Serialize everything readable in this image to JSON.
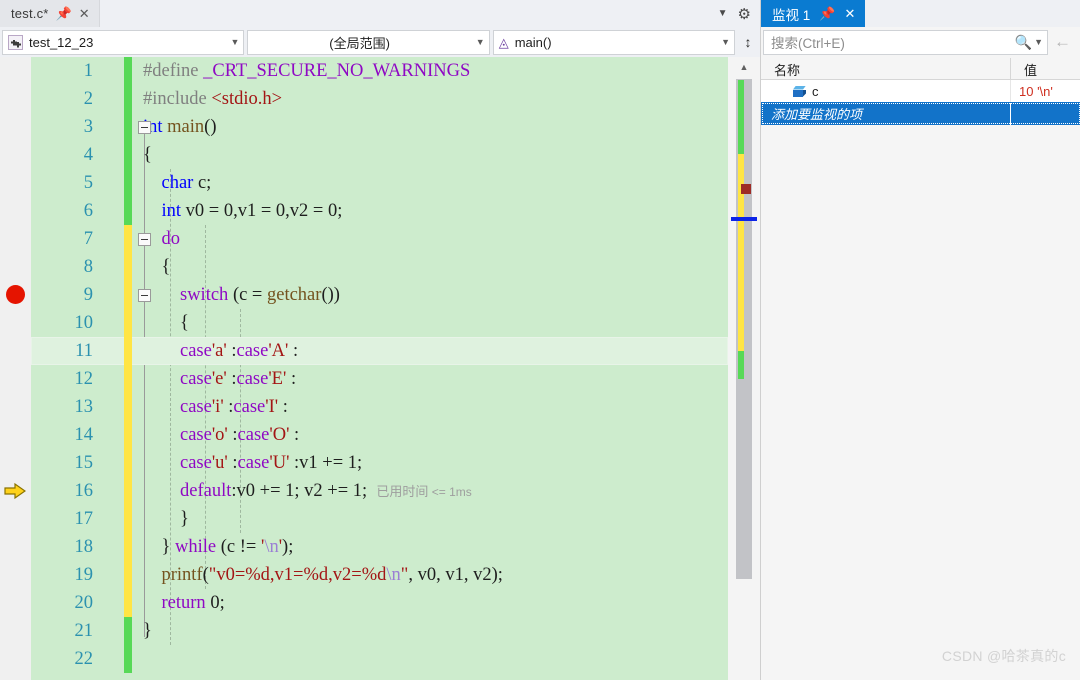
{
  "editor": {
    "tab": {
      "title": "test.c*",
      "pin_icon": "pin-icon",
      "close_icon": "close-icon"
    },
    "tabstrip_right": {
      "dropdown_icon": "chevron-down-icon",
      "settings_icon": "gear-icon"
    },
    "navbar": {
      "project": "test_12_23",
      "scope": "(全局范围)",
      "member": "main()",
      "split_icon": "split-window-icon",
      "caret_icon": "chevron-down-icon"
    },
    "gutter": {
      "breakpoint_line": 9,
      "current_line_marker_line": 16,
      "current_highlight_line": 11
    },
    "lines": [
      {
        "n": 1,
        "bar": "green",
        "html": "<span class='pp'>#define</span> <span class='mac'>_CRT_SECURE_NO_WARNINGS</span>",
        "text": "#define _CRT_SECURE_NO_WARNINGS"
      },
      {
        "n": 2,
        "bar": "green",
        "html": "<span class='pp'>#include</span> <span class='str'>&lt;stdio.h&gt;</span>",
        "text": "#include <stdio.h>"
      },
      {
        "n": 3,
        "bar": "green",
        "html": "<span class='k'>int</span> <span class='fn'>main</span><span class='pl'>()</span>",
        "text": "int main()"
      },
      {
        "n": 4,
        "bar": "green",
        "html": "<span class='pl'>{</span>",
        "text": "{"
      },
      {
        "n": 5,
        "bar": "green",
        "html": "    <span class='k'>char</span> <span class='pl'>c;</span>",
        "text": "    char c;"
      },
      {
        "n": 6,
        "bar": "green",
        "html": "    <span class='k'>int</span> <span class='pl'>v0 = 0,v1 = 0,v2 = 0;</span>",
        "text": "    int v0 = 0,v1 = 0,v2 = 0;"
      },
      {
        "n": 7,
        "bar": "yellow",
        "html": "    <span class='kw'>do</span>",
        "text": "    do"
      },
      {
        "n": 8,
        "bar": "yellow",
        "html": "    <span class='pl'>{</span>",
        "text": "    {"
      },
      {
        "n": 9,
        "bar": "yellow",
        "html": "        <span class='kw'>switch</span> <span class='pl'>(c = </span><span class='fn'>getchar</span><span class='pl'>())</span>",
        "text": "        switch (c = getchar())"
      },
      {
        "n": 10,
        "bar": "yellow",
        "html": "        <span class='pl'>{</span>",
        "text": "        {"
      },
      {
        "n": 11,
        "bar": "yellow",
        "html": "        <span class='kw'>case</span><span class='str'>'a'</span> <span class='pl'>:</span><span class='kw'>case</span><span class='str'>'A'</span> <span class='pl'>:</span>",
        "text": "        case'a' :case'A' :"
      },
      {
        "n": 12,
        "bar": "yellow",
        "html": "        <span class='kw'>case</span><span class='str'>'e'</span> <span class='pl'>:</span><span class='kw'>case</span><span class='str'>'E'</span> <span class='pl'>:</span>",
        "text": "        case'e' :case'E' :"
      },
      {
        "n": 13,
        "bar": "yellow",
        "html": "        <span class='kw'>case</span><span class='str'>'i'</span> <span class='pl'>:</span><span class='kw'>case</span><span class='str'>'I'</span> <span class='pl'>:</span>",
        "text": "        case'i' :case'I' :"
      },
      {
        "n": 14,
        "bar": "yellow",
        "html": "        <span class='kw'>case</span><span class='str'>'o'</span> <span class='pl'>:</span><span class='kw'>case</span><span class='str'>'O'</span> <span class='pl'>:</span>",
        "text": "        case'o' :case'O' :"
      },
      {
        "n": 15,
        "bar": "yellow",
        "html": "        <span class='kw'>case</span><span class='str'>'u'</span> <span class='pl'>:</span><span class='kw'>case</span><span class='str'>'U'</span> <span class='pl'>:v1 += 1;</span>",
        "text": "        case'u' :case'U' :v1 += 1;"
      },
      {
        "n": 16,
        "bar": "yellow",
        "html": "        <span class='kw'>default</span><span class='pl'>:v0 += 1; v2 += 1;</span>  <span class='tip'>已用时间<span class='small'> &lt;= 1ms</span></span>",
        "text": "        default:v0 += 1; v2 += 1;"
      },
      {
        "n": 17,
        "bar": "yellow",
        "html": "        <span class='pl'>}</span>",
        "text": "        }"
      },
      {
        "n": 18,
        "bar": "yellow",
        "html": "    <span class='pl'>}</span> <span class='kw'>while</span> <span class='pl'>(c != </span><span class='str'>'</span><span class='esc'>\\n</span><span class='str'>'</span><span class='pl'>);</span>",
        "text": "    } while (c != '\\n');"
      },
      {
        "n": 19,
        "bar": "yellow",
        "html": "    <span class='fn'>printf</span><span class='pl'>(</span><span class='str'>\"v0=%d,v1=%d,v2=%d</span><span class='esc'>\\n</span><span class='str'>\"</span><span class='pl'>, v0, v1, v2);</span>",
        "text": "    printf(\"v0=%d,v1=%d,v2=%d\\n\", v0, v1, v2);"
      },
      {
        "n": 20,
        "bar": "yellow",
        "html": "    <span class='kw'>return</span> <span class='pl'>0;</span>",
        "text": "    return 0;"
      },
      {
        "n": 21,
        "bar": "green",
        "html": "<span class='pl'>}</span>",
        "text": "}"
      },
      {
        "n": 22,
        "bar": "green",
        "html": "",
        "text": ""
      }
    ],
    "elapsed_tip": "已用时间 <= 1ms",
    "scrollbar": {
      "up_icon": "scroll-up-icon"
    }
  },
  "watch": {
    "tab": {
      "title": "监视 1",
      "pin_icon": "pin-icon",
      "close_icon": "close-icon"
    },
    "search": {
      "placeholder": "搜索(Ctrl+E)",
      "value": "",
      "icon": "search-icon",
      "caret_icon": "chevron-down-icon"
    },
    "nav_back_icon": "arrow-left-icon",
    "columns": {
      "name": "名称",
      "value": "值"
    },
    "rows": [
      {
        "icon": "variable-box-icon",
        "name": "c",
        "value": "10 '\\n'"
      }
    ],
    "add_row_label": "添加要监视的项"
  },
  "watermark": "CSDN @哈茶真的c",
  "colors": {
    "editor_bg": "#cdeccd",
    "current_line": "#dff2df",
    "watch_tab": "#0a7bd1",
    "selection": "#1273c9",
    "breakpoint": "#e51400",
    "change_saved": "#57d957",
    "change_unsaved": "#ffe544",
    "value_text": "#cf2f20"
  }
}
